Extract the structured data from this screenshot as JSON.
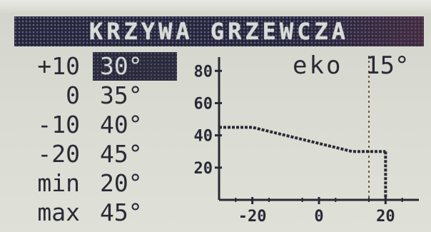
{
  "title": "KRZYWA GRZEWCZA",
  "curve_rows": [
    {
      "outdoor": "+10",
      "setpoint": "30°",
      "selected": true
    },
    {
      "outdoor": "0",
      "setpoint": "35°",
      "selected": false
    },
    {
      "outdoor": "-10",
      "setpoint": "40°",
      "selected": false
    },
    {
      "outdoor": "-20",
      "setpoint": "45°",
      "selected": false
    },
    {
      "outdoor": "min",
      "setpoint": "20°",
      "selected": false
    },
    {
      "outdoor": "max",
      "setpoint": "45°",
      "selected": false
    }
  ],
  "eko": {
    "label": "eko",
    "value": "15°",
    "threshold_x": 15
  },
  "chart_data": {
    "type": "line",
    "x_ticks": [
      "-20",
      "0",
      "20"
    ],
    "y_ticks": [
      "20",
      "40",
      "60",
      "80"
    ],
    "xlim": [
      -30,
      30
    ],
    "ylim": [
      0,
      85
    ],
    "series": [
      {
        "x": [
          -30,
          -20,
          -10,
          0,
          10,
          20
        ],
        "values": [
          45,
          45,
          40,
          35,
          30,
          30
        ]
      }
    ],
    "cutoff_x": 20,
    "eko_line_x": 15
  },
  "colors": {
    "lcd_background": "#dedfd6",
    "pixel_dark": "#2a2a36",
    "title_bar": "#24243a",
    "dotted_line": "#6b5a3a"
  }
}
